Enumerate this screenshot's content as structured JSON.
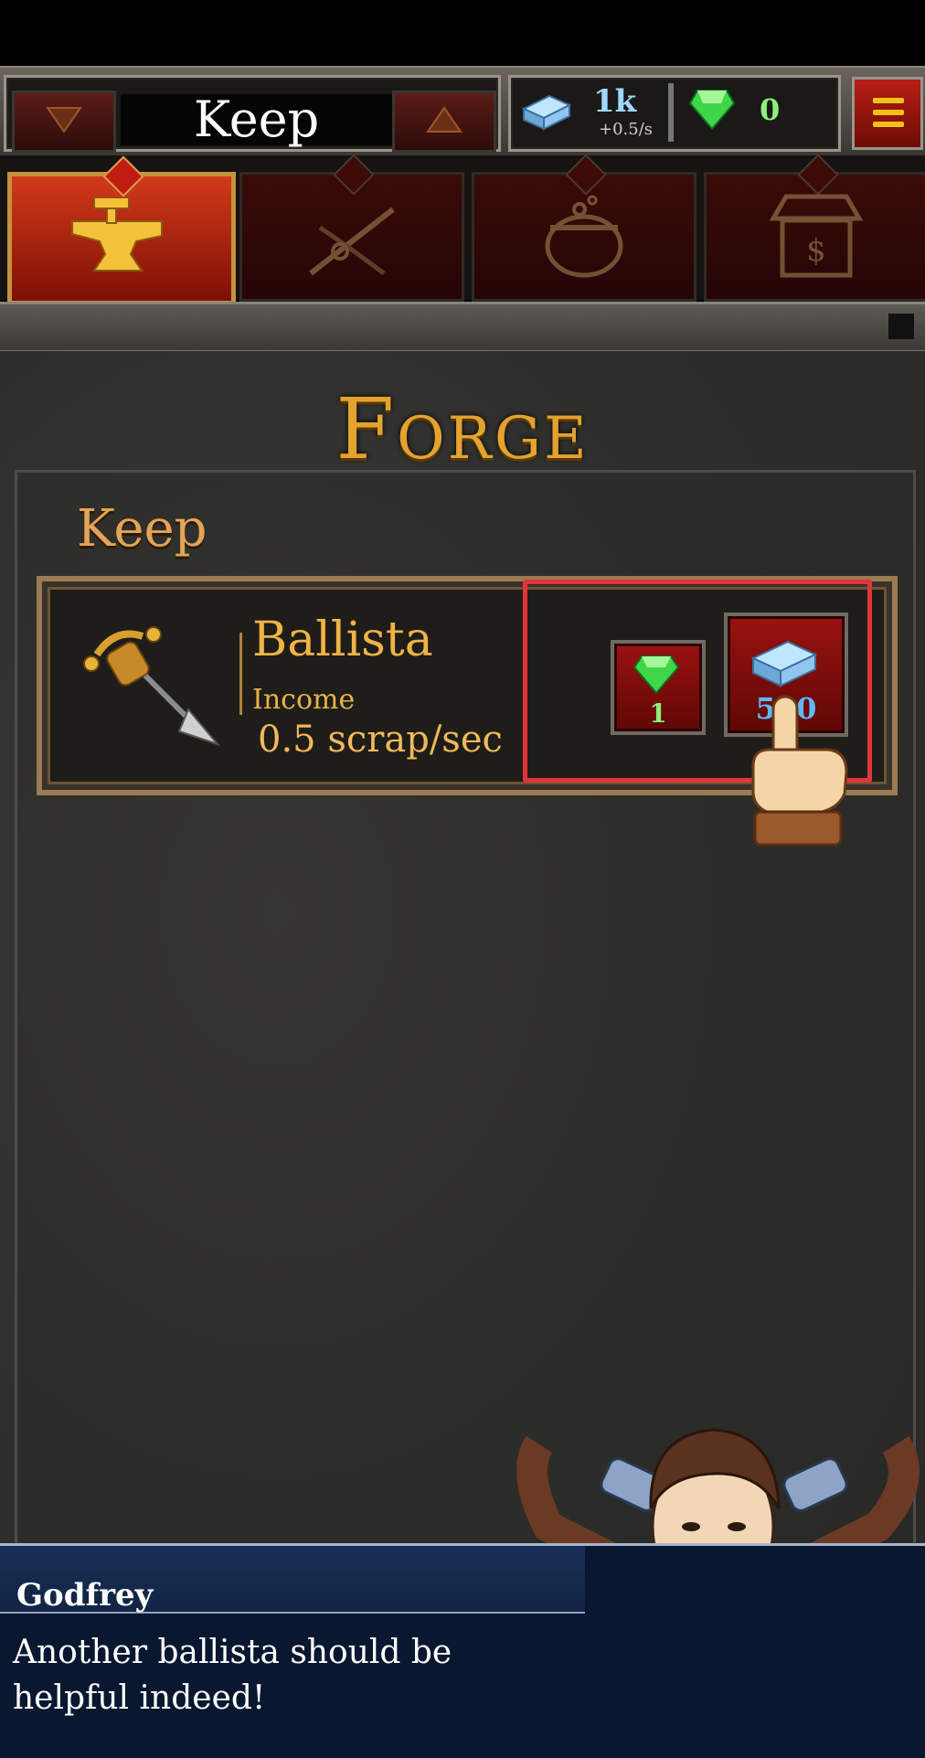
{
  "header": {
    "location_title": "Keep",
    "prev_icon": "triangle-down-icon",
    "next_icon": "triangle-up-icon",
    "scrap_amount": "1k",
    "scrap_rate": "+0.5/s",
    "gem_amount": "0",
    "menu_icon": "hamburger-menu-icon"
  },
  "tabs": [
    {
      "name": "forge",
      "icon": "anvil-icon",
      "active": true
    },
    {
      "name": "weapons",
      "icon": "crossbow-icon",
      "active": false
    },
    {
      "name": "alchemy",
      "icon": "cauldron-icon",
      "active": false
    },
    {
      "name": "shop",
      "icon": "market-stall-icon",
      "active": false
    }
  ],
  "main": {
    "title": "Forge",
    "section_title": "Keep",
    "item": {
      "name": "Ballista",
      "income_label": "Income",
      "income_value": "0.5 scrap/sec",
      "gem_cost": "1",
      "scrap_cost": "500"
    }
  },
  "dialogue": {
    "speaker": "Godfrey",
    "text": "Another ballista should be helpful indeed!"
  },
  "colors": {
    "gold_title": "#e4a32e",
    "highlight": "#e3343a",
    "button_red": "#9a1210",
    "dialogue_bg": "#0a1730"
  }
}
